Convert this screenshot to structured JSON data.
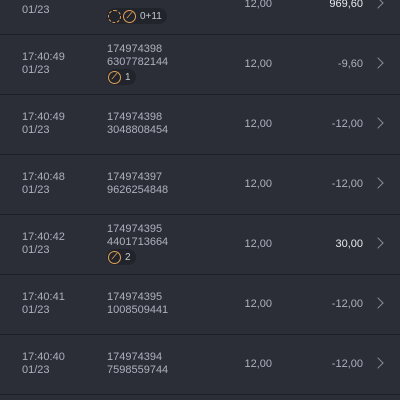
{
  "rows": [
    {
      "time": "",
      "date": "01/23",
      "id_line1": "",
      "id_line2": "6377529857",
      "amount": "12,00",
      "result": "969,60",
      "badge": {
        "icons": [
          "refresh-icon",
          "link-icon"
        ],
        "count": "0+11"
      }
    },
    {
      "time": "17:40:49",
      "date": "01/23",
      "id_line1": "174974398",
      "id_line2": "6307782144",
      "amount": "12,00",
      "result": "-9,60",
      "badge": {
        "icons": [
          "link-icon"
        ],
        "count": "1"
      }
    },
    {
      "time": "17:40:49",
      "date": "01/23",
      "id_line1": "174974398",
      "id_line2": "3048808454",
      "amount": "12,00",
      "result": "-12,00"
    },
    {
      "time": "17:40:48",
      "date": "01/23",
      "id_line1": "174974397",
      "id_line2": "9626254848",
      "amount": "12,00",
      "result": "-12,00"
    },
    {
      "time": "17:40:42",
      "date": "01/23",
      "id_line1": "174974395",
      "id_line2": "4401713664",
      "amount": "12,00",
      "result": "30,00",
      "badge": {
        "icons": [
          "link-icon"
        ],
        "count": "2"
      }
    },
    {
      "time": "17:40:41",
      "date": "01/23",
      "id_line1": "174974395",
      "id_line2": "1008509441",
      "amount": "12,00",
      "result": "-12,00"
    },
    {
      "time": "17:40:40",
      "date": "01/23",
      "id_line1": "174974394",
      "id_line2": "7598559744",
      "amount": "12,00",
      "result": "-12,00"
    }
  ]
}
